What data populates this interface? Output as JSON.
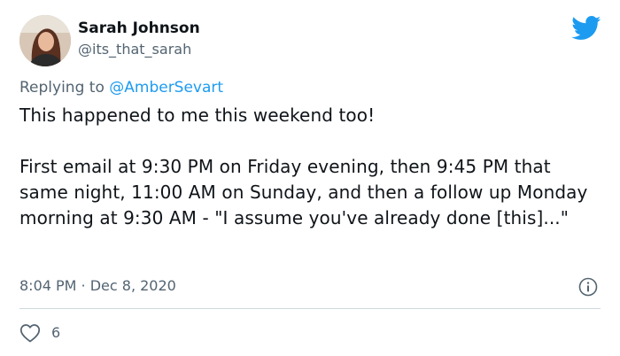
{
  "author": {
    "name": "Sarah Johnson",
    "handle": "@its_that_sarah"
  },
  "reply": {
    "prefix": "Replying to ",
    "mention": "@AmberSevart"
  },
  "tweet": {
    "text": "This happened to me this weekend too!\n\nFirst email at 9:30 PM on Friday evening, then 9:45 PM that same night, 11:00 AM on Sunday, and then a follow up Monday morning at 9:30 AM - \"I assume you've already done [this]...\"",
    "timestamp": "8:04 PM · Dec 8, 2020"
  },
  "actions": {
    "like_count": "6"
  },
  "icons": {
    "brand": "twitter-bird-icon",
    "info": "info-icon",
    "like": "heart-icon"
  },
  "colors": {
    "brand": "#1d9bf0",
    "text": "#0f1419",
    "secondary": "#536471",
    "divider": "#cfd9de"
  }
}
